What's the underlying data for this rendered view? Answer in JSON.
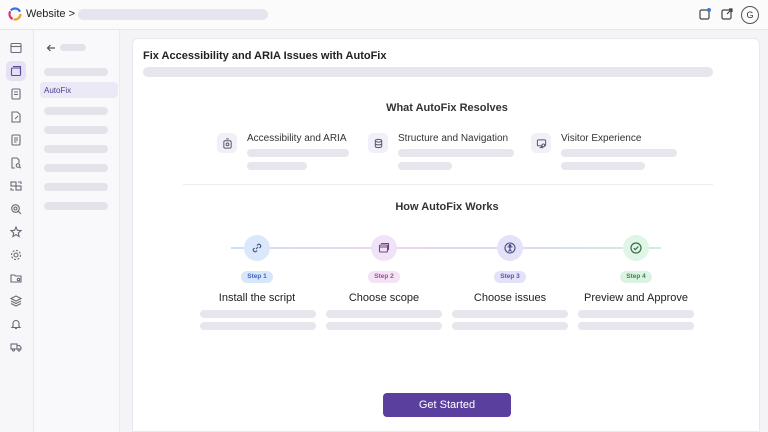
{
  "topbar": {
    "brand": "Website >",
    "icons": [
      "notification-icon",
      "external-link-icon"
    ],
    "avatar_initial": "G"
  },
  "rail": {
    "icons": [
      "dashboard-icon",
      "browser-icon",
      "pages-icon",
      "document-edit-icon",
      "list-icon",
      "file-search-icon",
      "image-icon",
      "search-icon",
      "star-icon",
      "settings-icon",
      "folder-icon",
      "layers-icon",
      "bell-icon",
      "truck-icon"
    ],
    "active_index": 1
  },
  "subnav": {
    "active_item": "AutoFix"
  },
  "main": {
    "title": "Fix Accessibility and ARIA Issues with AutoFix",
    "resolves_title": "What AutoFix Resolves",
    "features": [
      {
        "label": "Accessibility and ARIA",
        "icon": "accessibility-icon"
      },
      {
        "label": "Structure and Navigation",
        "icon": "database-icon"
      },
      {
        "label": "Visitor Experience",
        "icon": "monitor-icon"
      }
    ],
    "works_title": "How AutoFix Works",
    "steps": [
      {
        "badge": "Step 1",
        "title": "Install the script",
        "icon": "link-icon",
        "color": "#dbe8fb",
        "badge_color": "#d7e6fb",
        "badge_text": "#3e66c0"
      },
      {
        "badge": "Step 2",
        "title": "Choose scope",
        "icon": "window-icon",
        "color": "#f1e3f7",
        "badge_color": "#f4e2f5",
        "badge_text": "#a0499e"
      },
      {
        "badge": "Step 3",
        "title": "Choose issues",
        "icon": "person-icon",
        "color": "#e4e2f8",
        "badge_color": "#e3e2f8",
        "badge_text": "#5a51b5"
      },
      {
        "badge": "Step 4",
        "title": "Preview and Approve",
        "icon": "check-circle-icon",
        "color": "#dff5e6",
        "badge_color": "#dcf3e3",
        "badge_text": "#2f8a4f"
      }
    ],
    "cta_label": "Get Started",
    "accent": "#5b3f9e"
  }
}
